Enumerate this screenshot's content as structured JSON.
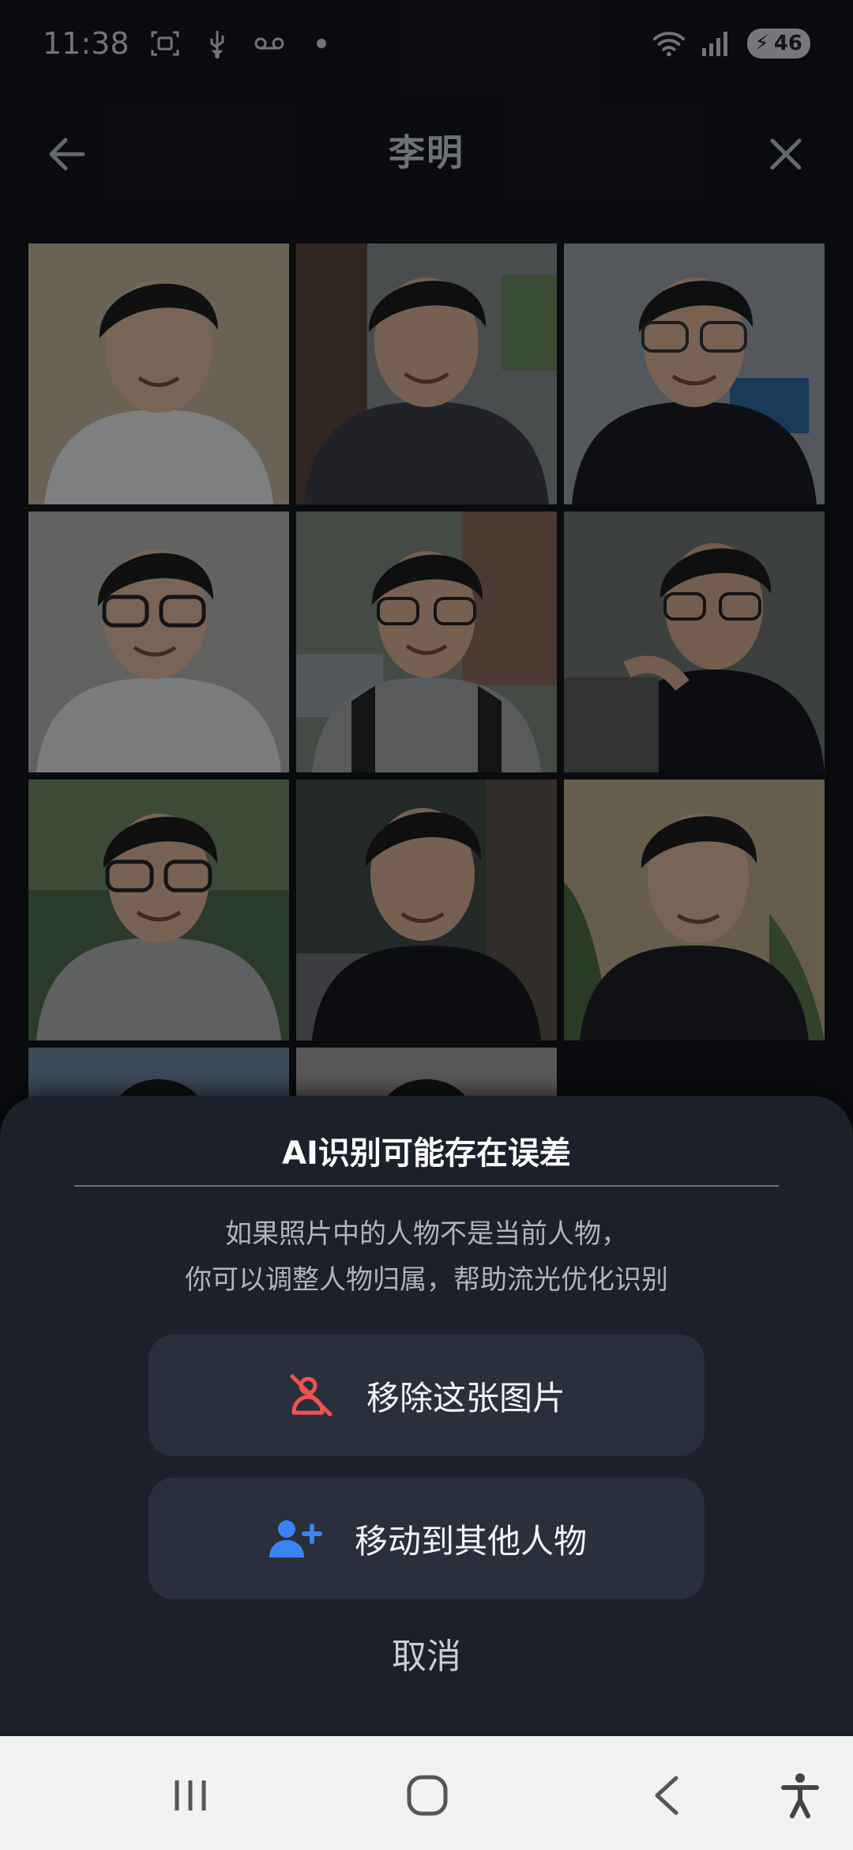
{
  "status_bar": {
    "time": "11:38",
    "icons": [
      "screenshot-icon",
      "usb-icon",
      "voicemail-icon",
      "dot-icon"
    ],
    "right_icons": [
      "wifi-icon",
      "signal-icon"
    ],
    "battery": "46"
  },
  "header": {
    "title": "李明",
    "back_icon": "arrow-left-icon",
    "close_icon": "close-icon"
  },
  "sheet": {
    "title": "AI识别可能存在误差",
    "description_line1": "如果照片中的人物不是当前人物，",
    "description_line2": "你可以调整人物归属，帮助流光优化识别",
    "remove_label": "移除这张图片",
    "move_label": "移动到其他人物",
    "cancel_label": "取消",
    "colors": {
      "remove_icon": "#f05252",
      "move_icon": "#3b82f6"
    }
  },
  "nav_bar": {
    "items": [
      "recent-apps-icon",
      "home-icon",
      "back-icon",
      "accessibility-icon"
    ]
  }
}
